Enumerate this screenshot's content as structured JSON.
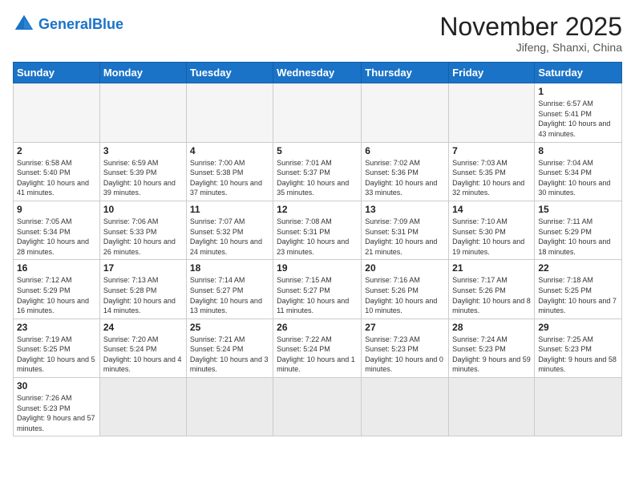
{
  "header": {
    "logo_general": "General",
    "logo_blue": "Blue",
    "month_title": "November 2025",
    "subtitle": "Jifeng, Shanxi, China"
  },
  "weekdays": [
    "Sunday",
    "Monday",
    "Tuesday",
    "Wednesday",
    "Thursday",
    "Friday",
    "Saturday"
  ],
  "weeks": [
    [
      {
        "day": "",
        "info": ""
      },
      {
        "day": "",
        "info": ""
      },
      {
        "day": "",
        "info": ""
      },
      {
        "day": "",
        "info": ""
      },
      {
        "day": "",
        "info": ""
      },
      {
        "day": "",
        "info": ""
      },
      {
        "day": "1",
        "info": "Sunrise: 6:57 AM\nSunset: 5:41 PM\nDaylight: 10 hours and 43 minutes."
      }
    ],
    [
      {
        "day": "2",
        "info": "Sunrise: 6:58 AM\nSunset: 5:40 PM\nDaylight: 10 hours and 41 minutes."
      },
      {
        "day": "3",
        "info": "Sunrise: 6:59 AM\nSunset: 5:39 PM\nDaylight: 10 hours and 39 minutes."
      },
      {
        "day": "4",
        "info": "Sunrise: 7:00 AM\nSunset: 5:38 PM\nDaylight: 10 hours and 37 minutes."
      },
      {
        "day": "5",
        "info": "Sunrise: 7:01 AM\nSunset: 5:37 PM\nDaylight: 10 hours and 35 minutes."
      },
      {
        "day": "6",
        "info": "Sunrise: 7:02 AM\nSunset: 5:36 PM\nDaylight: 10 hours and 33 minutes."
      },
      {
        "day": "7",
        "info": "Sunrise: 7:03 AM\nSunset: 5:35 PM\nDaylight: 10 hours and 32 minutes."
      },
      {
        "day": "8",
        "info": "Sunrise: 7:04 AM\nSunset: 5:34 PM\nDaylight: 10 hours and 30 minutes."
      }
    ],
    [
      {
        "day": "9",
        "info": "Sunrise: 7:05 AM\nSunset: 5:34 PM\nDaylight: 10 hours and 28 minutes."
      },
      {
        "day": "10",
        "info": "Sunrise: 7:06 AM\nSunset: 5:33 PM\nDaylight: 10 hours and 26 minutes."
      },
      {
        "day": "11",
        "info": "Sunrise: 7:07 AM\nSunset: 5:32 PM\nDaylight: 10 hours and 24 minutes."
      },
      {
        "day": "12",
        "info": "Sunrise: 7:08 AM\nSunset: 5:31 PM\nDaylight: 10 hours and 23 minutes."
      },
      {
        "day": "13",
        "info": "Sunrise: 7:09 AM\nSunset: 5:31 PM\nDaylight: 10 hours and 21 minutes."
      },
      {
        "day": "14",
        "info": "Sunrise: 7:10 AM\nSunset: 5:30 PM\nDaylight: 10 hours and 19 minutes."
      },
      {
        "day": "15",
        "info": "Sunrise: 7:11 AM\nSunset: 5:29 PM\nDaylight: 10 hours and 18 minutes."
      }
    ],
    [
      {
        "day": "16",
        "info": "Sunrise: 7:12 AM\nSunset: 5:29 PM\nDaylight: 10 hours and 16 minutes."
      },
      {
        "day": "17",
        "info": "Sunrise: 7:13 AM\nSunset: 5:28 PM\nDaylight: 10 hours and 14 minutes."
      },
      {
        "day": "18",
        "info": "Sunrise: 7:14 AM\nSunset: 5:27 PM\nDaylight: 10 hours and 13 minutes."
      },
      {
        "day": "19",
        "info": "Sunrise: 7:15 AM\nSunset: 5:27 PM\nDaylight: 10 hours and 11 minutes."
      },
      {
        "day": "20",
        "info": "Sunrise: 7:16 AM\nSunset: 5:26 PM\nDaylight: 10 hours and 10 minutes."
      },
      {
        "day": "21",
        "info": "Sunrise: 7:17 AM\nSunset: 5:26 PM\nDaylight: 10 hours and 8 minutes."
      },
      {
        "day": "22",
        "info": "Sunrise: 7:18 AM\nSunset: 5:25 PM\nDaylight: 10 hours and 7 minutes."
      }
    ],
    [
      {
        "day": "23",
        "info": "Sunrise: 7:19 AM\nSunset: 5:25 PM\nDaylight: 10 hours and 5 minutes."
      },
      {
        "day": "24",
        "info": "Sunrise: 7:20 AM\nSunset: 5:24 PM\nDaylight: 10 hours and 4 minutes."
      },
      {
        "day": "25",
        "info": "Sunrise: 7:21 AM\nSunset: 5:24 PM\nDaylight: 10 hours and 3 minutes."
      },
      {
        "day": "26",
        "info": "Sunrise: 7:22 AM\nSunset: 5:24 PM\nDaylight: 10 hours and 1 minute."
      },
      {
        "day": "27",
        "info": "Sunrise: 7:23 AM\nSunset: 5:23 PM\nDaylight: 10 hours and 0 minutes."
      },
      {
        "day": "28",
        "info": "Sunrise: 7:24 AM\nSunset: 5:23 PM\nDaylight: 9 hours and 59 minutes."
      },
      {
        "day": "29",
        "info": "Sunrise: 7:25 AM\nSunset: 5:23 PM\nDaylight: 9 hours and 58 minutes."
      }
    ],
    [
      {
        "day": "30",
        "info": "Sunrise: 7:26 AM\nSunset: 5:23 PM\nDaylight: 9 hours and 57 minutes."
      },
      {
        "day": "",
        "info": ""
      },
      {
        "day": "",
        "info": ""
      },
      {
        "day": "",
        "info": ""
      },
      {
        "day": "",
        "info": ""
      },
      {
        "day": "",
        "info": ""
      },
      {
        "day": "",
        "info": ""
      }
    ]
  ]
}
